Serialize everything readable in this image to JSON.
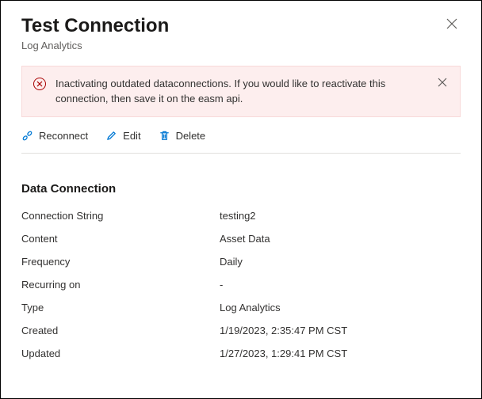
{
  "header": {
    "title": "Test Connection",
    "subtitle": "Log Analytics"
  },
  "alert": {
    "message": "Inactivating outdated dataconnections. If you would like to reactivate this connection, then save it on the easm api."
  },
  "toolbar": {
    "reconnect_label": "Reconnect",
    "edit_label": "Edit",
    "delete_label": "Delete"
  },
  "section": {
    "title": "Data Connection"
  },
  "fields": {
    "connection_string": {
      "label": "Connection String",
      "value": "testing2"
    },
    "content": {
      "label": "Content",
      "value": "Asset Data"
    },
    "frequency": {
      "label": "Frequency",
      "value": "Daily"
    },
    "recurring_on": {
      "label": "Recurring on",
      "value": "-"
    },
    "type": {
      "label": "Type",
      "value": "Log Analytics"
    },
    "created": {
      "label": "Created",
      "value": "1/19/2023, 2:35:47 PM CST"
    },
    "updated": {
      "label": "Updated",
      "value": "1/27/2023, 1:29:41 PM CST"
    }
  }
}
